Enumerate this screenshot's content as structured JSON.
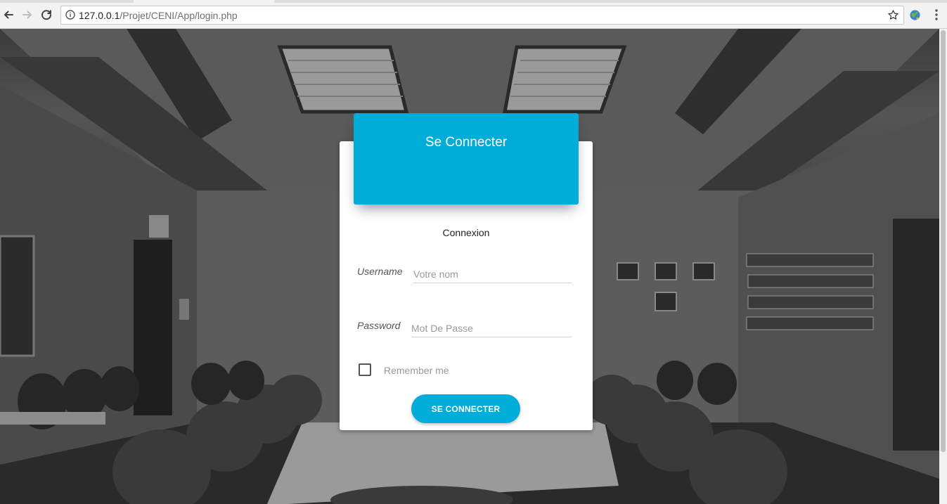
{
  "browser": {
    "url_host": "127.0.0.1",
    "url_path": "/Projet/CENI/App/login.php",
    "icons": {
      "back": "back-arrow-icon",
      "forward": "forward-arrow-icon",
      "reload": "reload-icon",
      "info": "info-icon",
      "bookmark": "star-icon",
      "extension": "globe-extension-icon",
      "menu": "kebab-menu-icon"
    }
  },
  "login": {
    "header_title": "Se Connecter",
    "subtitle": "Connexion",
    "username_label": "Username",
    "username_placeholder": "Votre nom",
    "password_label": "Password",
    "password_placeholder": "Mot De Passe",
    "remember_label": "Remember me",
    "remember_checked": false,
    "submit_label": "SE CONNECTER"
  },
  "colors": {
    "accent": "#00acd8",
    "card_bg": "#ffffff",
    "background": "#3a3a3a"
  }
}
